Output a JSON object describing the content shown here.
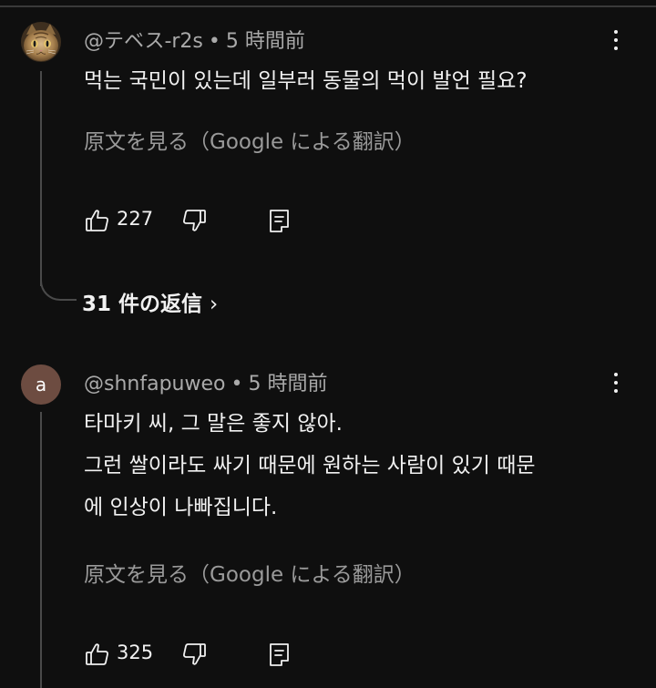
{
  "comments": [
    {
      "author": "@テベス-r2s",
      "time": "5 時間前",
      "avatar_letter": "",
      "text_lines": [
        "먹는 국민이 있는데 일부러 동물의 먹이 발언 필요?"
      ],
      "translate_label": "原文を見る（Google による翻訳）",
      "likes": "227",
      "replies_label": "31 件の返信",
      "replies_chevron": "›"
    },
    {
      "author": "@shnfapuweo",
      "time": "5 時間前",
      "avatar_letter": "a",
      "text_lines": [
        "타마키 씨, 그 말은 좋지 않아.",
        "그런 쌀이라도 싸기 때문에 원하는 사람이 있기 때문",
        "에 인상이 나빠집니다."
      ],
      "translate_label": "原文を見る（Google による翻訳）",
      "likes": "325"
    }
  ],
  "separator": "•",
  "colors": {
    "background": "#0f0f0f",
    "text": "#f1f1f1",
    "muted": "#aaaaaa",
    "avatar_brown": "#6d4c41",
    "thread_line": "#4a4a4a"
  },
  "icons": {
    "avatar_1": "cat-avatar-icon",
    "like": "thumbs-up-icon",
    "dislike": "thumbs-down-icon",
    "reply": "reply-comment-icon",
    "menu": "kebab-menu-icon"
  }
}
